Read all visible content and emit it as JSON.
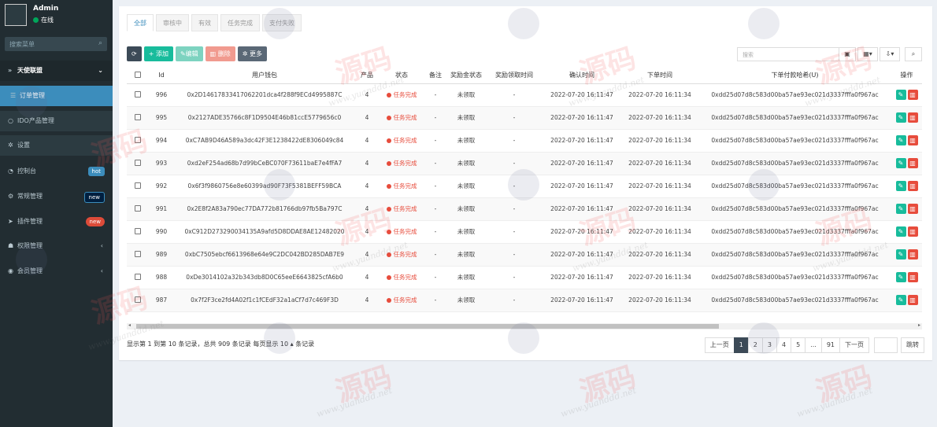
{
  "user": {
    "name": "Admin",
    "status": "在线"
  },
  "sidebar": {
    "search_placeholder": "搜索菜单",
    "items": [
      {
        "label": "天使联盟",
        "icon": "angle-double-right-icon"
      },
      {
        "label": "订单管理",
        "icon": "list-icon"
      },
      {
        "label": "IDO产品管理",
        "icon": "circle-icon"
      },
      {
        "label": "设置",
        "icon": "gear-icon"
      },
      {
        "label": "控制台",
        "icon": "dashboard-icon",
        "badge": "hot"
      },
      {
        "label": "常规管理",
        "icon": "cogs-icon",
        "badge": "new"
      },
      {
        "label": "插件管理",
        "icon": "rocket-icon",
        "badge": "new"
      },
      {
        "label": "权限管理",
        "icon": "group-icon"
      },
      {
        "label": "会员管理",
        "icon": "user-circle-icon"
      }
    ]
  },
  "tabs": [
    "全部",
    "审核中",
    "有效",
    "任务完成",
    "支付失败"
  ],
  "toolbar": {
    "refresh": "⟳",
    "add": "添加",
    "edit": "编辑",
    "delete": "删除",
    "more": "更多"
  },
  "search": {
    "placeholder": "搜索"
  },
  "table": {
    "headers": [
      "",
      "Id",
      "用户钱包",
      "产品",
      "状态",
      "备注",
      "奖励金状态",
      "奖励领取时间",
      "确认时间",
      "下单时间",
      "下单付款哈希(U)",
      "操作"
    ],
    "rows": [
      {
        "id": "996",
        "wallet": "0x2D14617833417062201dca4f288f9ECd4995887C",
        "product": "4",
        "status": "任务完成",
        "note": "-",
        "reward_status": "未领取",
        "reward_time": "-",
        "confirm_time": "2022-07-20 16:11:47",
        "order_time": "2022-07-20 16:11:34",
        "hash": "0xdd25d07d8c583d00ba57ae93ec021d3337fffa0f967ac"
      },
      {
        "id": "995",
        "wallet": "0x2127ADE35766c8F1D9504E46b81ccE5779656c0",
        "product": "4",
        "status": "任务完成",
        "note": "-",
        "reward_status": "未领取",
        "reward_time": "-",
        "confirm_time": "2022-07-20 16:11:47",
        "order_time": "2022-07-20 16:11:34",
        "hash": "0xdd25d07d8c583d00ba57ae93ec021d3337fffa0f967ac"
      },
      {
        "id": "994",
        "wallet": "0xC7AB9D46A589a3dc42F3E1238422dE8306049c84",
        "product": "4",
        "status": "任务完成",
        "note": "-",
        "reward_status": "未领取",
        "reward_time": "-",
        "confirm_time": "2022-07-20 16:11:47",
        "order_time": "2022-07-20 16:11:34",
        "hash": "0xdd25d07d8c583d00ba57ae93ec021d3337fffa0f967ac"
      },
      {
        "id": "993",
        "wallet": "0xd2eF254ad68b7d99bCeBC070F73611baE7e4fFA7",
        "product": "4",
        "status": "任务完成",
        "note": "-",
        "reward_status": "未领取",
        "reward_time": "-",
        "confirm_time": "2022-07-20 16:11:47",
        "order_time": "2022-07-20 16:11:34",
        "hash": "0xdd25d07d8c583d00ba57ae93ec021d3337fffa0f967ac"
      },
      {
        "id": "992",
        "wallet": "0x6f3f9860756e8e60399ad90F73F5381BEFF59BCA",
        "product": "4",
        "status": "任务完成",
        "note": "-",
        "reward_status": "未领取",
        "reward_time": "-",
        "confirm_time": "2022-07-20 16:11:47",
        "order_time": "2022-07-20 16:11:34",
        "hash": "0xdd25d07d8c583d00ba57ae93ec021d3337fffa0f967ac"
      },
      {
        "id": "991",
        "wallet": "0x2E8f2A83a790ec77DA772b81766db97fb5Ba797C",
        "product": "4",
        "status": "任务完成",
        "note": "-",
        "reward_status": "未领取",
        "reward_time": "-",
        "confirm_time": "2022-07-20 16:11:47",
        "order_time": "2022-07-20 16:11:34",
        "hash": "0xdd25d07d8c583d00ba57ae93ec021d3337fffa0f967ac"
      },
      {
        "id": "990",
        "wallet": "0xC912D273290034135A9afd5D8DDAE8AE12482020",
        "product": "4",
        "status": "任务完成",
        "note": "-",
        "reward_status": "未领取",
        "reward_time": "-",
        "confirm_time": "2022-07-20 16:11:47",
        "order_time": "2022-07-20 16:11:34",
        "hash": "0xdd25d07d8c583d00ba57ae93ec021d3337fffa0f967ac"
      },
      {
        "id": "989",
        "wallet": "0xbC7505ebcf6613968e64e9C2DC042BD285DAB7E9",
        "product": "4",
        "status": "任务完成",
        "note": "-",
        "reward_status": "未领取",
        "reward_time": "-",
        "confirm_time": "2022-07-20 16:11:47",
        "order_time": "2022-07-20 16:11:34",
        "hash": "0xdd25d07d8c583d00ba57ae93ec021d3337fffa0f967ac"
      },
      {
        "id": "988",
        "wallet": "0xDe3014102a32b343db8D0C65eeE6643825cfA6b0",
        "product": "4",
        "status": "任务完成",
        "note": "-",
        "reward_status": "未领取",
        "reward_time": "-",
        "confirm_time": "2022-07-20 16:11:47",
        "order_time": "2022-07-20 16:11:34",
        "hash": "0xdd25d07d8c583d00ba57ae93ec021d3337fffa0f967ac"
      },
      {
        "id": "987",
        "wallet": "0x7f2F3ce2fd4A02f1c1fCEdF32a1aCf7d7c469F3D",
        "product": "4",
        "status": "任务完成",
        "note": "-",
        "reward_status": "未领取",
        "reward_time": "-",
        "confirm_time": "2022-07-20 16:11:47",
        "order_time": "2022-07-20 16:11:34",
        "hash": "0xdd25d07d8c583d00ba57ae93ec021d3337fffa0f967ac"
      }
    ]
  },
  "pagination": {
    "info_prefix": "显示第 1 到第 10 条记录，总共 909 条记录 每页显示",
    "page_size": "10 ▴",
    "info_suffix": "条记录",
    "prev": "上一页",
    "pages": [
      "1",
      "2",
      "3",
      "4",
      "5",
      "...",
      "91"
    ],
    "next": "下一页",
    "jump": "跳转"
  },
  "watermark": {
    "text": "源码",
    "subtext": "www.yuanddd.net"
  },
  "colors": {
    "sidebar_bg": "#222d32",
    "active": "#3c8dbc",
    "success": "#18bc9c",
    "danger": "#e74c3c"
  }
}
